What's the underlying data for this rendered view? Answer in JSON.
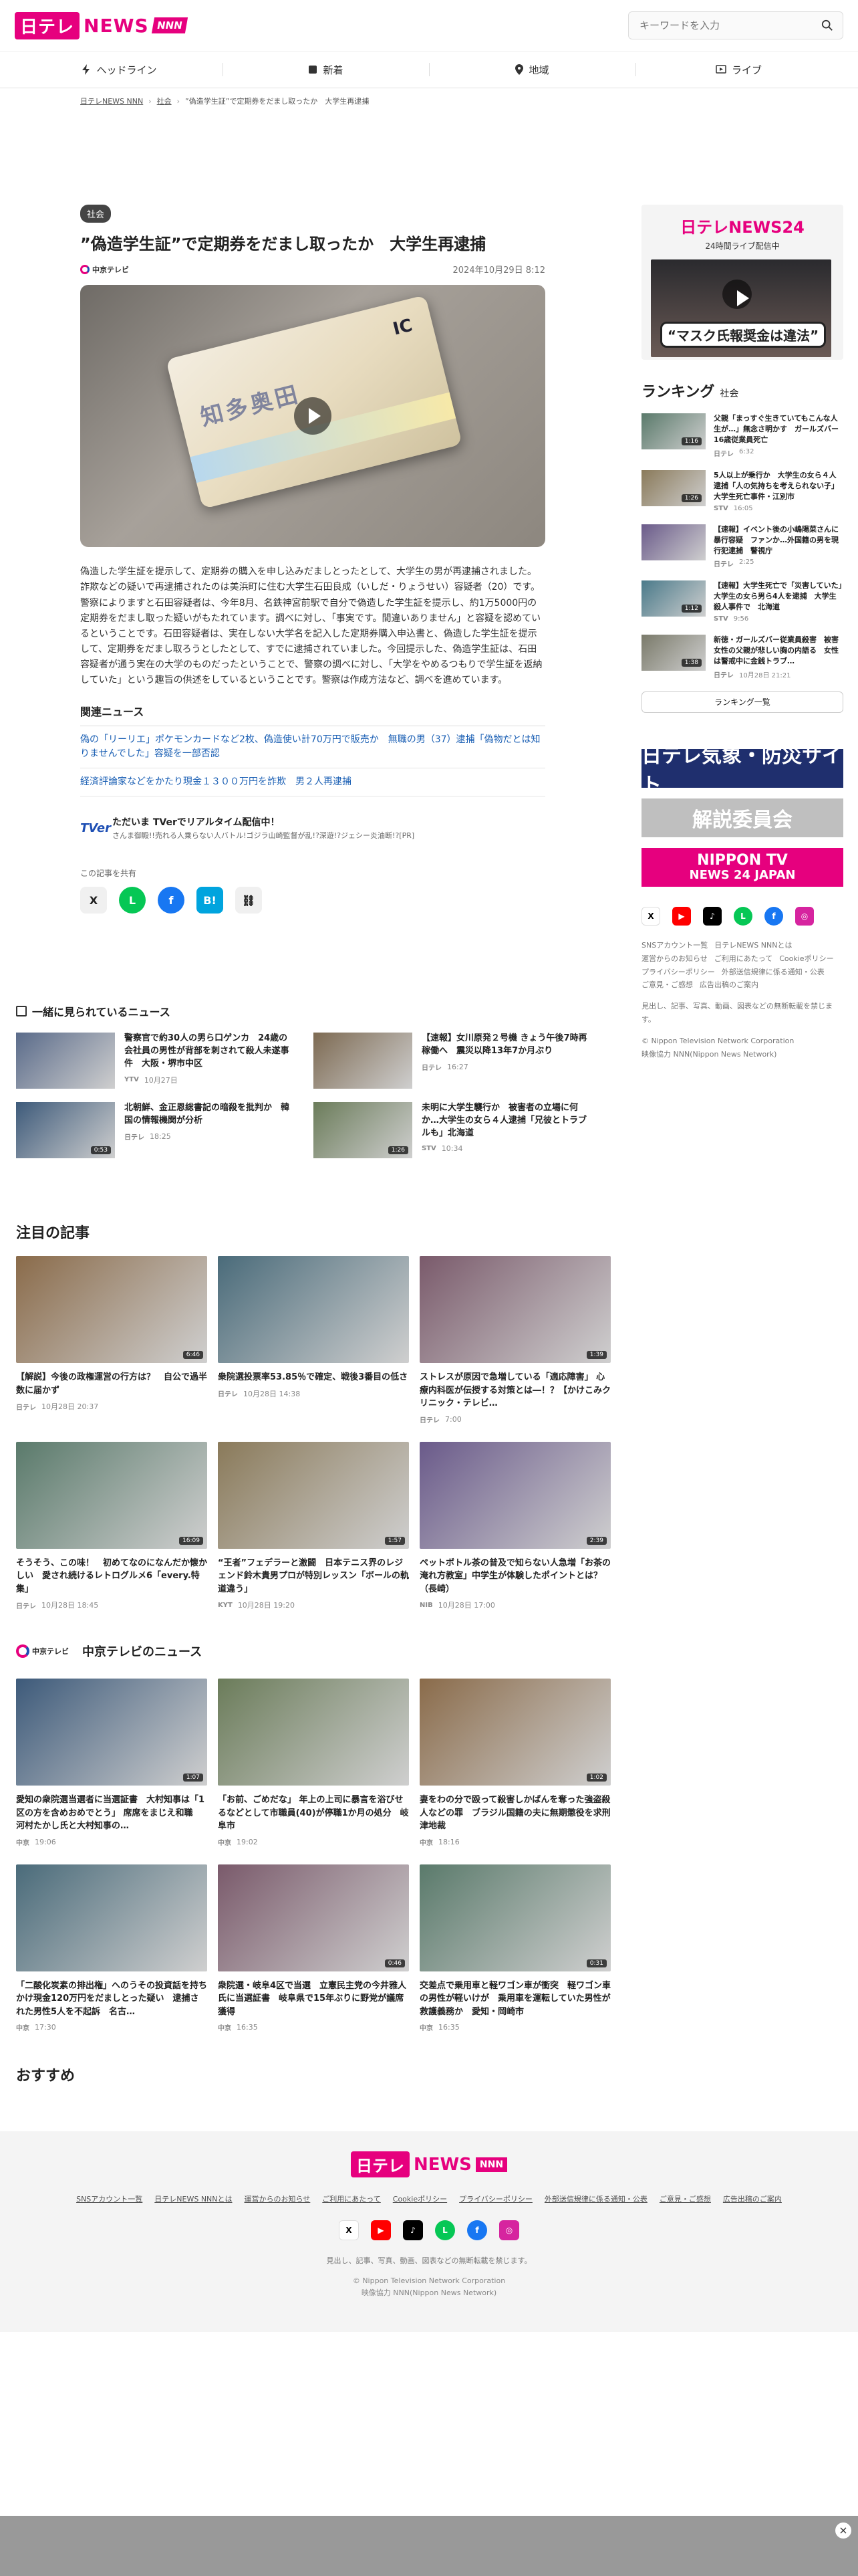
{
  "brand": {
    "logo": "日テレ",
    "logo2": "NEWS",
    "logo3": "NNN"
  },
  "search": {
    "placeholder": "キーワードを入力"
  },
  "nav": [
    "ヘッドライン",
    "新着",
    "地域",
    "ライブ"
  ],
  "breadcrumb": [
    "日テレNEWS NNN",
    "社会",
    "”偽造学生証”で定期券をだまし取ったか　大学生再逮捕"
  ],
  "article": {
    "tag": "社会",
    "title": "”偽造学生証”で定期券をだまし取ったか　大学生再逮捕",
    "source": "中京テレビ",
    "date": "2024年10月29日 8:12",
    "card_code": "IC",
    "card_text": "知多奥田",
    "p1": "偽造した学生証を提示して、定期券の購入を申し込みだましとったとして、大学生の男が再逮捕されました。",
    "p2": "詐欺などの疑いで再逮捕されたのは美浜町に住む大学生石田良成（いしだ・りょうせい）容疑者（20）です。",
    "p3": "警察によりますと石田容疑者は、今年8月、名鉄神宮前駅で自分で偽造した学生証を提示し、約1万5000円の定期券をだまし取った疑いがもたれています。調べに対し、「事実です。間違いありません」と容疑を認めているということです。石田容疑者は、実在しない大学名を記入した定期券購入申込書と、偽造した学生証を提示して、定期券をだまし取ろうとしたとして、すでに逮捕されていました。今回提示した、偽造学生証は、石田容疑者が通う実在の大学のものだったということで、警察の調べに対し、「大学をやめるつもりで学生証を返納していた」という趣旨の供述をしているということです。警察は作成方法など、調べを進めています。",
    "related_head": "関連ニュース",
    "related": [
      "偽の「リーリエ」ポケモンカードなど2枚、偽造使い計70万円で販売か　無職の男（37）逮捕「偽物だとは知りませんでした」容疑を一部否認",
      "経済評論家などをかたり現金１３００万円を詐欺　男２人再逮捕"
    ],
    "tver_logo": "TVer",
    "tver_title": "ただいま TVerでリアルタイム配信中！",
    "tver_sub": "さんま御殿!!売れる人乗らない人バトル!ゴジラ山崎監督が乱!?深遊!?ジェシー炎油断!?[PR]",
    "share_label": "この記事を共有",
    "share_buttons": [
      "X",
      "L",
      "f",
      "B!",
      "⛓"
    ]
  },
  "seen": {
    "head": "一緒に見られているニュース",
    "items": [
      {
        "title": "警察官で約30人の男ら口ゲンカ　24歳の会社員の男性が背部を刺されて殺人未遂事件　大阪・堺市中区",
        "src": "YTV",
        "date": "10月27日",
        "dur": ""
      },
      {
        "title": "【速報】女川原発２号機 きょう午後7時再稼働へ　震災以降13年7か月ぶり",
        "src": "日テレ",
        "date": "16:27",
        "dur": ""
      },
      {
        "title": "北朝鮮、金正恩総書記の暗殺を批判か　韓国の情報機関が分析",
        "src": "日テレ",
        "date": "18:25",
        "dur": "0:53"
      },
      {
        "title": "未明に大学生襲行か　被害者の立場に何か…大学生の女ら４人逮捕「兄彼とトラブルも」北海道",
        "src": "STV",
        "date": "10:34",
        "dur": "1:26"
      }
    ]
  },
  "featured": {
    "head": "注目の記事",
    "items": [
      {
        "title": "【解説】今後の政権運営の行方は？　自公で過半数に届かず",
        "src": "日テレ",
        "date": "10月28日 20:37",
        "dur": "6:46"
      },
      {
        "title": "衆院選投票率53.85％で確定、戦後3番目の低さ",
        "src": "日テレ",
        "date": "10月28日 14:38",
        "dur": ""
      },
      {
        "title": "ストレスが原因で急増している「適応障害」 心療内科医が伝授する対策とは―！？【かけこみクリニック・テレビ…",
        "src": "日テレ",
        "date": "7:00",
        "dur": "1:39"
      },
      {
        "title": "そうそう、この味！　初めてなのになんだか懐かしい　愛され続けるレトログルメ6「every.特集」",
        "src": "日テレ",
        "date": "10月28日 18:45",
        "dur": "16:09"
      },
      {
        "title": "“王者”フェデラーと激闘　日本テニス界のレジェンド鈴木貴男プロが特別レッスン「ボールの軌道違う」",
        "src": "KYT",
        "date": "10月28日 19:20",
        "dur": "1:57"
      },
      {
        "title": "ペットボトル茶の普及で知らない人急増「お茶の淹れ方教室」中学生が体験したポイントとは？（長崎）",
        "src": "NIB",
        "date": "10月28日 17:00",
        "dur": "2:39"
      }
    ]
  },
  "chukyo": {
    "head": "中京テレビのニュース",
    "mark": "中京テレビ",
    "items": [
      {
        "title": "愛知の衆院選当選者に当選証書　大村知事は「1区の方を含めおめでとう」 席席をまじえ和職　河村たかし氏と大村知事の…",
        "src": "中京",
        "date": "19:06",
        "dur": "1:07"
      },
      {
        "title": "「お前、ごめだな」 年上の上司に暴言を浴びせるなどとして市職員(40)が停職1か月の処分　岐阜市",
        "src": "中京",
        "date": "19:02",
        "dur": ""
      },
      {
        "title": "妻をわの分で殴って殺害しかばんを奪った強盗殺人などの罪　ブラジル国籍の夫に無期懲役を求刑　津地裁",
        "src": "中京",
        "date": "18:16",
        "dur": "1:02"
      },
      {
        "title": "「二酸化炭素の排出権」へのうその投資話を持ちかけ現金120万円をだましとった疑い　逮捕された男性5人を不起訴　名古…",
        "src": "中京",
        "date": "17:30",
        "dur": ""
      },
      {
        "title": "衆院選・岐阜4区で当選　立憲民主党の今井雅人氏に当選証書　岐阜県で15年ぶりに野党が議席獲得",
        "src": "中京",
        "date": "16:35",
        "dur": "0:46"
      },
      {
        "title": "交差点で乗用車と軽ワゴン車が衝突　軽ワゴン車の男性が軽いけが　乗用車を運転していた男性が救護義務か　愛知・岡崎市",
        "src": "中京",
        "date": "16:35",
        "dur": "0:31"
      }
    ]
  },
  "osusume": "おすすめ",
  "sidebar": {
    "n24_title": "日テレNEWS24",
    "n24_sub": "24時間ライブ配信中",
    "n24_caption": "“マスク氏報奨金は違法”",
    "rank_head": "ランキング",
    "rank_cat": "社会",
    "rank": [
      {
        "title": "父親「まっすぐ生きていてもこんな人生が…」無念さ明かす　ガールズバー16歳従業員死亡",
        "src": "日テレ",
        "date": "6:32",
        "dur": "1:16"
      },
      {
        "title": "5人以上が乗行か　大学生の女ら４人逮捕「人の気持ちを考えられない子」大学生死亡事件・江別市",
        "src": "STV",
        "date": "16:05",
        "dur": "1:26"
      },
      {
        "title": "【速報】イベント後の小嶋陽菜さんに暴行容疑　ファンか…外国籍の男を現行犯逮捕　警視庁",
        "src": "日テレ",
        "date": "2:25",
        "dur": ""
      },
      {
        "title": "【速報】大学生死亡で「災害していた」大学生の女ら男ら4人を逮捕　大学生殺人事件で　北海道",
        "src": "STV",
        "date": "9:56",
        "dur": "1:12"
      },
      {
        "title": "新徳・ガールズバー従業員殺害　被害女性の父親が悲しい胸の内語る　女性は警戒中に金銭トラブ…",
        "src": "日テレ",
        "date": "10月28日 21:21",
        "dur": "1:38"
      }
    ],
    "rank_more": "ランキング一覧",
    "ban1": "日テレ気象・防災サイト",
    "ban2": "解説委員会",
    "ban3a": "NIPPON TV",
    "ban3b": "NEWS 24 JAPAN",
    "links": [
      "SNSアカウント一覧",
      "日テレNEWS NNNとは",
      "運営からのお知らせ",
      "ご利用にあたって",
      "Cookieポリシー",
      "プライバシーポリシー",
      "外部送信規律に係る通知・公表",
      "ご意見・ご感想",
      "広告出稿のご案内"
    ],
    "note": "見出し、記事、写真、動画、図表などの無断転載を禁じます。",
    "copy": "© Nippon Television Network Corporation\n映像協力 NNN(Nippon News Network)"
  },
  "footer": {
    "links": [
      "SNSアカウント一覧",
      "日テレNEWS NNNとは",
      "運営からのお知らせ",
      "ご利用にあたって",
      "Cookieポリシー",
      "プライバシーポリシー",
      "外部送信規律に係る通知・公表",
      "ご意見・ご感想",
      "広告出稿のご案内"
    ],
    "note": "見出し、記事、写真、動画、図表などの無断転載を禁じます。",
    "copy1": "© Nippon Television Network Corporation",
    "copy2": "映像協力 NNN(Nippon News Network)"
  },
  "colors": {
    "brand": "#e6007e",
    "link": "#1a5fb4"
  }
}
